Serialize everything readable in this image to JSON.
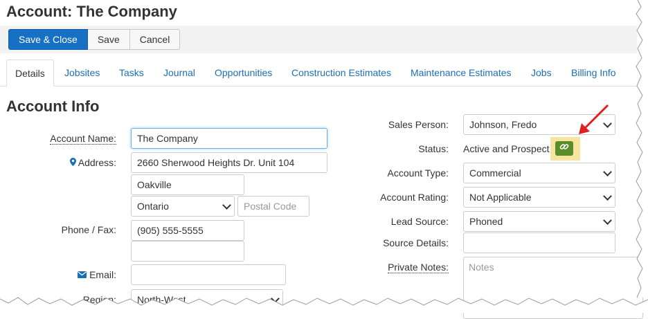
{
  "page": {
    "title": "Account: The Company"
  },
  "toolbar": {
    "save_close": "Save & Close",
    "save": "Save",
    "cancel": "Cancel"
  },
  "tabs": [
    "Details",
    "Jobsites",
    "Tasks",
    "Journal",
    "Opportunities",
    "Construction Estimates",
    "Maintenance Estimates",
    "Jobs",
    "Billing Info"
  ],
  "section": {
    "title": "Account Info"
  },
  "left": {
    "account_name_label": "Account Name:",
    "account_name": "The Company",
    "address_label": "Address:",
    "address_line": "2660 Sherwood Heights Dr. Unit 104",
    "city": "Oakville",
    "province": "Ontario",
    "postal_placeholder": "Postal Code",
    "phone_label": "Phone / Fax:",
    "phone": "(905) 555-5555",
    "fax": "",
    "email_label": "Email:",
    "email": "",
    "region_label": "Region:",
    "region": "North-West"
  },
  "right": {
    "sales_person_label": "Sales Person:",
    "sales_person": "Johnson, Fredo",
    "status_label": "Status:",
    "status": "Active and Prospect",
    "account_type_label": "Account Type:",
    "account_type": "Commercial",
    "account_rating_label": "Account Rating:",
    "account_rating": "Not Applicable",
    "lead_source_label": "Lead Source:",
    "lead_source": "Phoned",
    "source_details_label": "Source Details:",
    "source_details": "",
    "private_notes_label": "Private Notes:",
    "notes_placeholder": "Notes"
  },
  "colors": {
    "primary": "#1670c4",
    "link": "#1a6eb5",
    "link_button": "#5a8c2a",
    "highlight": "#f7e4a0",
    "annotation_arrow": "#e02020"
  },
  "icons": {
    "address": "map-marker-icon",
    "email": "envelope-icon",
    "status_link": "link-icon"
  }
}
